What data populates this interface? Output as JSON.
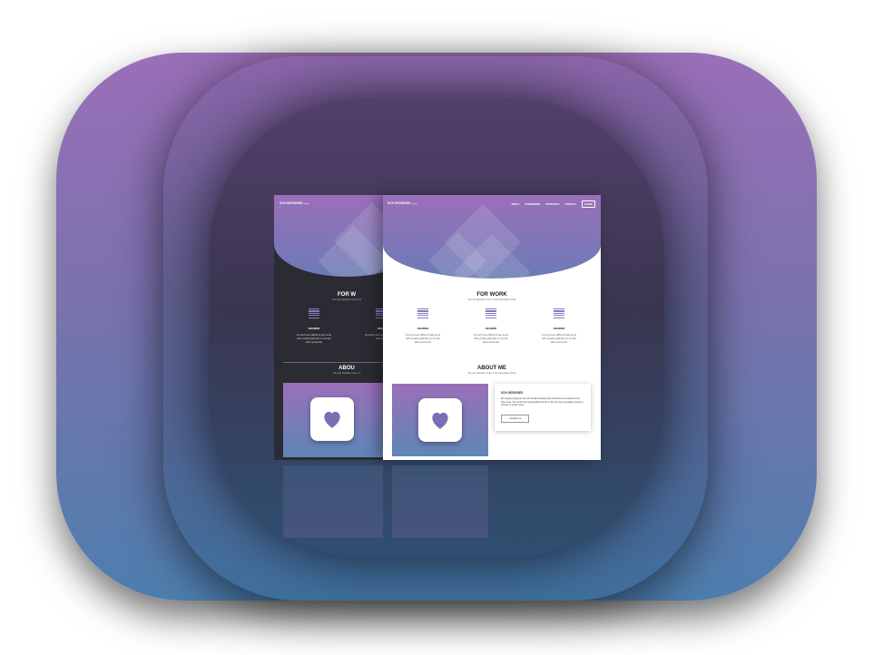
{
  "brand": {
    "name": "SCH DESIGNED",
    "suffix": "design"
  },
  "nav": {
    "items": [
      "ABOUT",
      "EXPERIENCE",
      "PORTFOLIO",
      "CONTACT"
    ],
    "button": "THEME"
  },
  "work": {
    "title": "FOR WORK",
    "subtitle": "You can describe more in the description there",
    "features": [
      {
        "icon": "list-icon",
        "header": "HEADER",
        "text": "It's much more difficult to play tennis with a bowling ball than it is to bowl with a tennis ball."
      },
      {
        "icon": "list-icon",
        "header": "HEADER",
        "text": "It's much more difficult to play tennis with a bowling ball than it is to bowl with a tennis ball."
      },
      {
        "icon": "list-icon",
        "header": "HEADER",
        "text": "It's much more difficult to play tennis with a bowling ball than it is to bowl with a tennis ball."
      }
    ]
  },
  "about": {
    "title": "ABOUT ME",
    "subtitle": "You can describe more in the description there",
    "card_title": "SCH DESIGNED",
    "card_text": "We stepped gingerly onto the bridge knowing that enchantment awaited on the other side. The sound formed beautiful sounds in the city that eventually created a tornado in rental house.",
    "card_button": "Contact me"
  },
  "dark_preview": {
    "title": "FOR W",
    "subtitle": "You can describe more in th",
    "about_title": "ABOU",
    "about_subtitle": "You can describe more in t",
    "feature_header": "HEADER",
    "feature_header_cut": "HEAD",
    "feature_text": "It's much more difficult to play tennis with a bowling ball than it is to bowl with a tennis ball.",
    "feature_text_cut": "It's much more tennis with a bo to bowl with a"
  },
  "colors": {
    "accent_purple": "#9b6fba",
    "accent_blue": "#5e86b6",
    "dark_bg": "#2b2c33",
    "heart": "#7a6fb5"
  }
}
